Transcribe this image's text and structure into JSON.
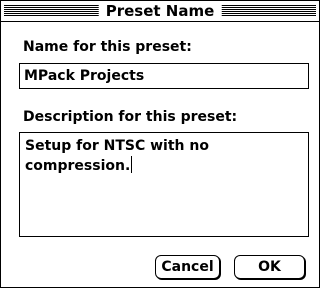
{
  "window": {
    "title": "Preset Name"
  },
  "name_section": {
    "label": "Name for this preset:",
    "value": "MPack Projects"
  },
  "description_section": {
    "label": "Description for this preset:",
    "value": "Setup for NTSC with no\ncompression."
  },
  "buttons": {
    "cancel_label": "Cancel",
    "ok_label": "OK"
  },
  "colors": {
    "border": "#000000",
    "background": "#ffffff",
    "text": "#000000"
  }
}
